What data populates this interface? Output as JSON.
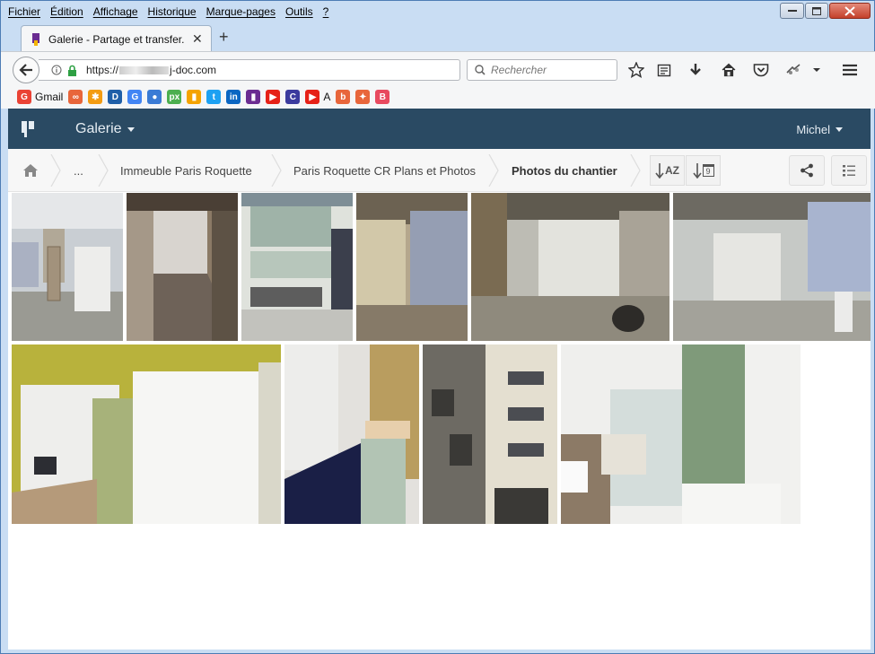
{
  "menubar": {
    "items": [
      "Fichier",
      "Édition",
      "Affichage",
      "Historique",
      "Marque-pages",
      "Outils",
      "?"
    ]
  },
  "tab": {
    "title": "Galerie - Partage et transfer..."
  },
  "navbar": {
    "url_prefix": "https://",
    "url_suffix": "j-doc.com",
    "search_placeholder": "Rechercher"
  },
  "bookmarks": [
    {
      "label": "Gmail",
      "icon": "google-icon",
      "color": "#ea4335",
      "glyph": "G"
    },
    {
      "label": "",
      "icon": "link-icon",
      "color": "#e8663b",
      "glyph": "∞"
    },
    {
      "label": "",
      "icon": "joomla-icon",
      "color": "#f39c12",
      "glyph": "✱"
    },
    {
      "label": "",
      "icon": "d-icon",
      "color": "#1f5fa8",
      "glyph": "D"
    },
    {
      "label": "",
      "icon": "google-icon",
      "color": "#4285f4",
      "glyph": "G"
    },
    {
      "label": "",
      "icon": "globe-icon",
      "color": "#3a7bd5",
      "glyph": "●"
    },
    {
      "label": "",
      "icon": "px-icon",
      "color": "#4caf50",
      "glyph": "px"
    },
    {
      "label": "",
      "icon": "analytics-icon",
      "color": "#f4a300",
      "glyph": "▮"
    },
    {
      "label": "",
      "icon": "twitter-icon",
      "color": "#1da1f2",
      "glyph": "t"
    },
    {
      "label": "",
      "icon": "linkedin-icon",
      "color": "#0a66c2",
      "glyph": "in"
    },
    {
      "label": "",
      "icon": "jdoc-icon",
      "color": "#6a2c91",
      "glyph": "▮"
    },
    {
      "label": "",
      "icon": "youtube-icon",
      "color": "#e62117",
      "glyph": "▶"
    },
    {
      "label": "",
      "icon": "c-icon",
      "color": "#3b3b9e",
      "glyph": "C"
    },
    {
      "label": "A",
      "icon": "youtube-icon",
      "color": "#e62117",
      "glyph": "▶"
    },
    {
      "label": "",
      "icon": "b-icon",
      "color": "#e8663b",
      "glyph": "b"
    },
    {
      "label": "",
      "icon": "fox-icon",
      "color": "#e8663b",
      "glyph": "✦"
    },
    {
      "label": "",
      "icon": "bookmark-b-icon",
      "color": "#e84a5f",
      "glyph": "B"
    }
  ],
  "app": {
    "gallery_label": "Galerie",
    "user_label": "Michel"
  },
  "breadcrumb": {
    "ellipsis": "...",
    "items": [
      "Immeuble Paris Roquette",
      "Paris Roquette CR Plans et Photos",
      "Photos du chantier"
    ]
  },
  "sort": {
    "alpha_label": "AZ",
    "date_label": "9"
  }
}
